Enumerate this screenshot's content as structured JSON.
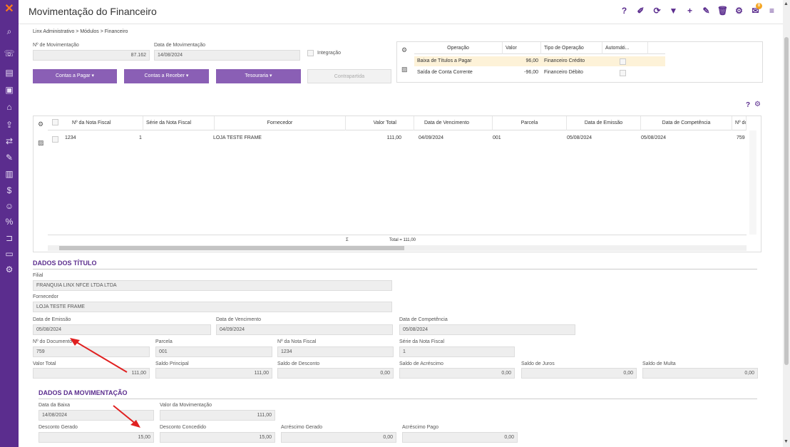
{
  "page_title": "Movimentação do Financeiro",
  "breadcrumb": "Linx Administrativo  >  Módulos  >  Financeiro",
  "toolbar_icons": [
    "help-icon",
    "eraser-icon",
    "refresh-icon",
    "filter-icon",
    "add-icon",
    "edit-icon",
    "delete-icon",
    "settings-icon",
    "notifications-icon",
    "menu-icon"
  ],
  "toolbar_glyphs": [
    "?",
    "✐",
    "⟳",
    "▼",
    "+",
    "✎",
    "🗑",
    "⚙",
    "✉",
    "≡"
  ],
  "notification_count": "0",
  "sidebar_icons": [
    "search-icon",
    "phone-icon",
    "list-icon",
    "tag-icon",
    "box-icon",
    "upload-icon",
    "transfer-icon",
    "tools-icon",
    "chart-icon",
    "dollar-icon",
    "people-icon",
    "percent-icon",
    "cart-icon",
    "screen-icon",
    "cogs-icon"
  ],
  "form": {
    "doc_num_label": "Nº de Movimentação",
    "doc_num_value": "87.162",
    "date_label": "Data de Movimentação",
    "date_value": "14/08/2024",
    "integration_label": "Integração"
  },
  "buttons": {
    "contas_pagar": "Contas a Pagar ▾",
    "contas_receber": "Contas a Receber ▾",
    "tesouraria": "Tesouraria ▾",
    "contrapartida": "Contrapartida"
  },
  "ops": {
    "headers": [
      "Operação",
      "Valor",
      "Tipo de Operação",
      "Automáti..."
    ],
    "rows": [
      {
        "operacao": "Baixa de Títulos a Pagar",
        "valor": "96,00",
        "tipo": "Financeiro Crédito"
      },
      {
        "operacao": "Saída de Conta Corrente",
        "valor": "-96,00",
        "tipo": "Financeiro Débito"
      }
    ]
  },
  "grid": {
    "headers": [
      "Nº da Nota Fiscal",
      "Série da Nota Fiscal",
      "Fornecedor",
      "Valor Total",
      "Data de Vencimento",
      "Parcela",
      "Data de Emissão",
      "Data de Competência",
      "Nº do"
    ],
    "row": {
      "nota": "1234",
      "serie": "1",
      "fornecedor": "LOJA TESTE FRAME",
      "valor": "111,00",
      "vencimento": "04/09/2024",
      "parcela": "001",
      "emissao": "05/08/2024",
      "competencia": "05/08/2024",
      "doc": "759"
    },
    "sigma": "Σ",
    "total_label": "Total = 111,00"
  },
  "titulo": {
    "heading": "DADOS DOS TÍTULO",
    "filial_label": "Filial",
    "filial_value": "FRANQUIA LINX NFCE LTDA LTDA",
    "fornecedor_label": "Fornecedor",
    "fornecedor_value": "LOJA TESTE FRAME",
    "emissao_label": "Data de Emissão",
    "emissao_value": "05/08/2024",
    "vencimento_label": "Data de Vencimento",
    "vencimento_value": "04/09/2024",
    "competencia_label": "Data de Competência",
    "competencia_value": "05/08/2024",
    "documento_label": "Nº do Documento",
    "documento_value": "759",
    "parcela_label": "Parcela",
    "parcela_value": "001",
    "nota_label": "Nº da Nota Fiscal",
    "nota_value": "1234",
    "serie_label": "Série da Nota Fiscal",
    "serie_value": "1",
    "valor_total_label": "Valor Total",
    "valor_total_value": "111,00",
    "saldo_principal_label": "Saldo Principal",
    "saldo_principal_value": "111,00",
    "saldo_desconto_label": "Saldo de Desconto",
    "saldo_desconto_value": "0,00",
    "saldo_acrescimo_label": "Saldo de Acréscimo",
    "saldo_acrescimo_value": "0,00",
    "saldo_juros_label": "Saldo de Juros",
    "saldo_juros_value": "0,00",
    "saldo_multa_label": "Saldo de Multa",
    "saldo_multa_value": "0,00"
  },
  "movimentacao": {
    "heading": "DADOS DA MOVIMENTAÇÃO",
    "baixa_label": "Data da Baixa",
    "baixa_value": "14/08/2024",
    "valor_label": "Valor da Movimentação",
    "valor_value": "111,00",
    "desc_gerado_label": "Desconto Gerado",
    "desc_gerado_value": "15,00",
    "desc_concedido_label": "Desconto Concedido",
    "desc_concedido_value": "15,00",
    "acr_gerado_label": "Acréscimo Gerado",
    "acr_gerado_value": "0,00",
    "acr_pago_label": "Acréscimo Pago",
    "acr_pago_value": "0,00"
  },
  "colors": {
    "sidebar": "#5b2d8e",
    "button": "#8a5fb5",
    "accent": "#5b2d8e",
    "arrow": "#e02020",
    "highlight_row": "#fdf2d8"
  }
}
